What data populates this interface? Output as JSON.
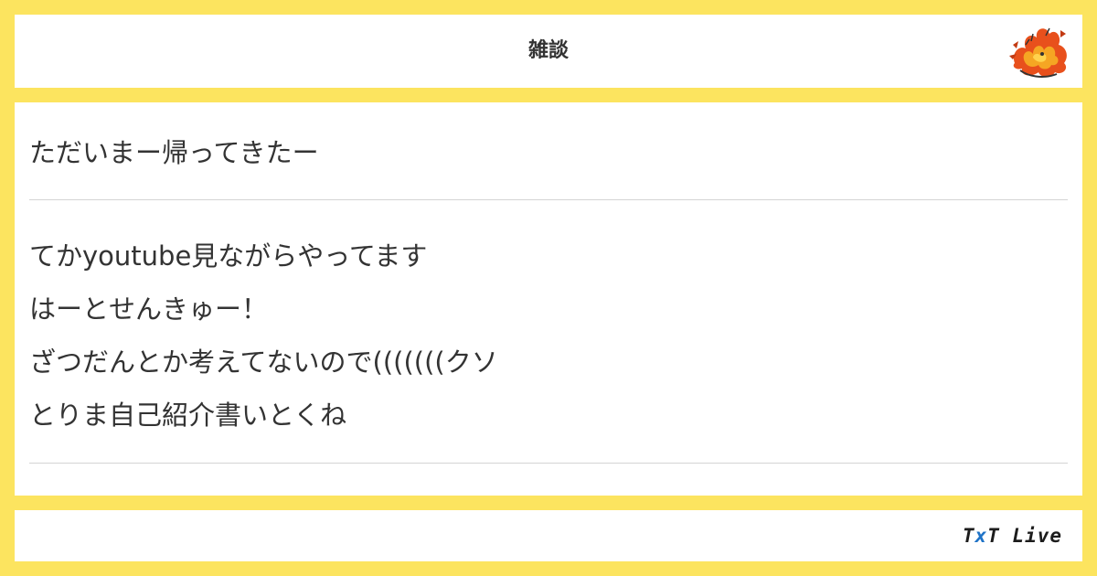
{
  "header": {
    "title": "雑談",
    "avatar_icon": "flame-creature-icon"
  },
  "post": {
    "first_block": [
      "ただいまー帰ってきたー"
    ],
    "second_block": [
      "てかyoutube見ながらやってます",
      "はーとせんきゅー！",
      "ざつだんとか考えてないので(((((((クソ",
      "とりま自己紹介書いとくね"
    ]
  },
  "footer": {
    "brand_part1": "T",
    "brand_x": "x",
    "brand_part2": "T Live"
  },
  "colors": {
    "background": "#fce45f",
    "panel": "#ffffff",
    "text": "#333333",
    "divider": "#d4d4d4",
    "brand_accent": "#1f73c7"
  }
}
